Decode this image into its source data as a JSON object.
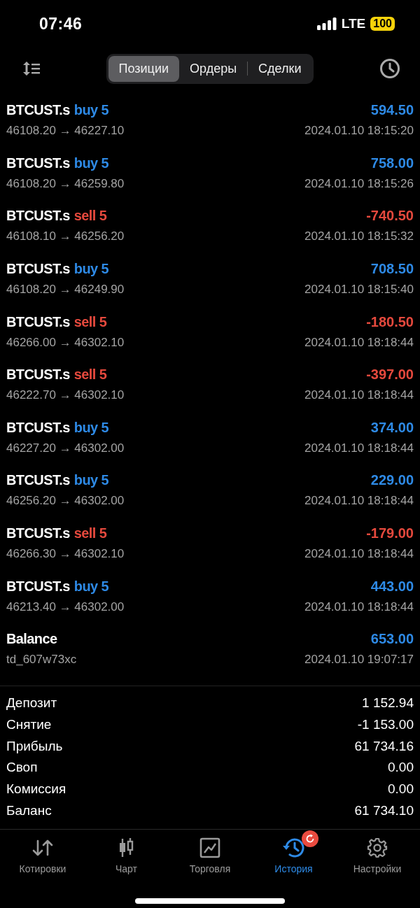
{
  "status_bar": {
    "time": "07:46",
    "network": "LTE",
    "battery": "100"
  },
  "segments": [
    {
      "label": "Позиции",
      "selected": true
    },
    {
      "label": "Ордеры",
      "selected": false
    },
    {
      "label": "Сделки",
      "selected": false
    }
  ],
  "deals": [
    {
      "kind": "deal",
      "symbol": "BTCUST.s",
      "sell": false,
      "volume": "buy 5",
      "profit": "594.50",
      "loss": false,
      "prices": "46108.20 → 46227.10",
      "time": "2024.01.10 18:15:20"
    },
    {
      "kind": "deal",
      "symbol": "BTCUST.s",
      "sell": false,
      "volume": "buy 5",
      "profit": "758.00",
      "loss": false,
      "prices": "46108.20 → 46259.80",
      "time": "2024.01.10 18:15:26"
    },
    {
      "kind": "deal",
      "symbol": "BTCUST.s",
      "sell": true,
      "volume": "sell 5",
      "profit": "-740.50",
      "loss": true,
      "prices": "46108.10 → 46256.20",
      "time": "2024.01.10 18:15:32"
    },
    {
      "kind": "deal",
      "symbol": "BTCUST.s",
      "sell": false,
      "volume": "buy 5",
      "profit": "708.50",
      "loss": false,
      "prices": "46108.20 → 46249.90",
      "time": "2024.01.10 18:15:40"
    },
    {
      "kind": "deal",
      "symbol": "BTCUST.s",
      "sell": true,
      "volume": "sell 5",
      "profit": "-180.50",
      "loss": true,
      "prices": "46266.00 → 46302.10",
      "time": "2024.01.10 18:18:44"
    },
    {
      "kind": "deal",
      "symbol": "BTCUST.s",
      "sell": true,
      "volume": "sell 5",
      "profit": "-397.00",
      "loss": true,
      "prices": "46222.70 → 46302.10",
      "time": "2024.01.10 18:18:44"
    },
    {
      "kind": "deal",
      "symbol": "BTCUST.s",
      "sell": false,
      "volume": "buy 5",
      "profit": "374.00",
      "loss": false,
      "prices": "46227.20 → 46302.00",
      "time": "2024.01.10 18:18:44"
    },
    {
      "kind": "deal",
      "symbol": "BTCUST.s",
      "sell": false,
      "volume": "buy 5",
      "profit": "229.00",
      "loss": false,
      "prices": "46256.20 → 46302.00",
      "time": "2024.01.10 18:18:44"
    },
    {
      "kind": "deal",
      "symbol": "BTCUST.s",
      "sell": true,
      "volume": "sell 5",
      "profit": "-179.00",
      "loss": true,
      "prices": "46266.30 → 46302.10",
      "time": "2024.01.10 18:18:44"
    },
    {
      "kind": "deal",
      "symbol": "BTCUST.s",
      "sell": false,
      "volume": "buy 5",
      "profit": "443.00",
      "loss": false,
      "prices": "46213.40 → 46302.00",
      "time": "2024.01.10 18:18:44"
    },
    {
      "kind": "balance",
      "symbol": "Balance",
      "profit": "653.00",
      "loss": false,
      "prices": "td_607w73xc",
      "time": "2024.01.10 19:07:17"
    }
  ],
  "summary": [
    {
      "label": "Депозит",
      "value": "1 152.94"
    },
    {
      "label": "Снятие",
      "value": "-1 153.00"
    },
    {
      "label": "Прибыль",
      "value": "61 734.16"
    },
    {
      "label": "Своп",
      "value": "0.00"
    },
    {
      "label": "Комиссия",
      "value": "0.00"
    },
    {
      "label": "Баланс",
      "value": "61 734.10"
    }
  ],
  "tabbar": [
    {
      "kind": "quotes",
      "label": "Котировки",
      "selected": false,
      "badge": false
    },
    {
      "kind": "chart",
      "label": "Чарт",
      "selected": false,
      "badge": false
    },
    {
      "kind": "trade",
      "label": "Торговля",
      "selected": false,
      "badge": false
    },
    {
      "kind": "history",
      "label": "История",
      "selected": true,
      "badge": true
    },
    {
      "kind": "settings",
      "label": "Настройки",
      "selected": false,
      "badge": false
    }
  ]
}
